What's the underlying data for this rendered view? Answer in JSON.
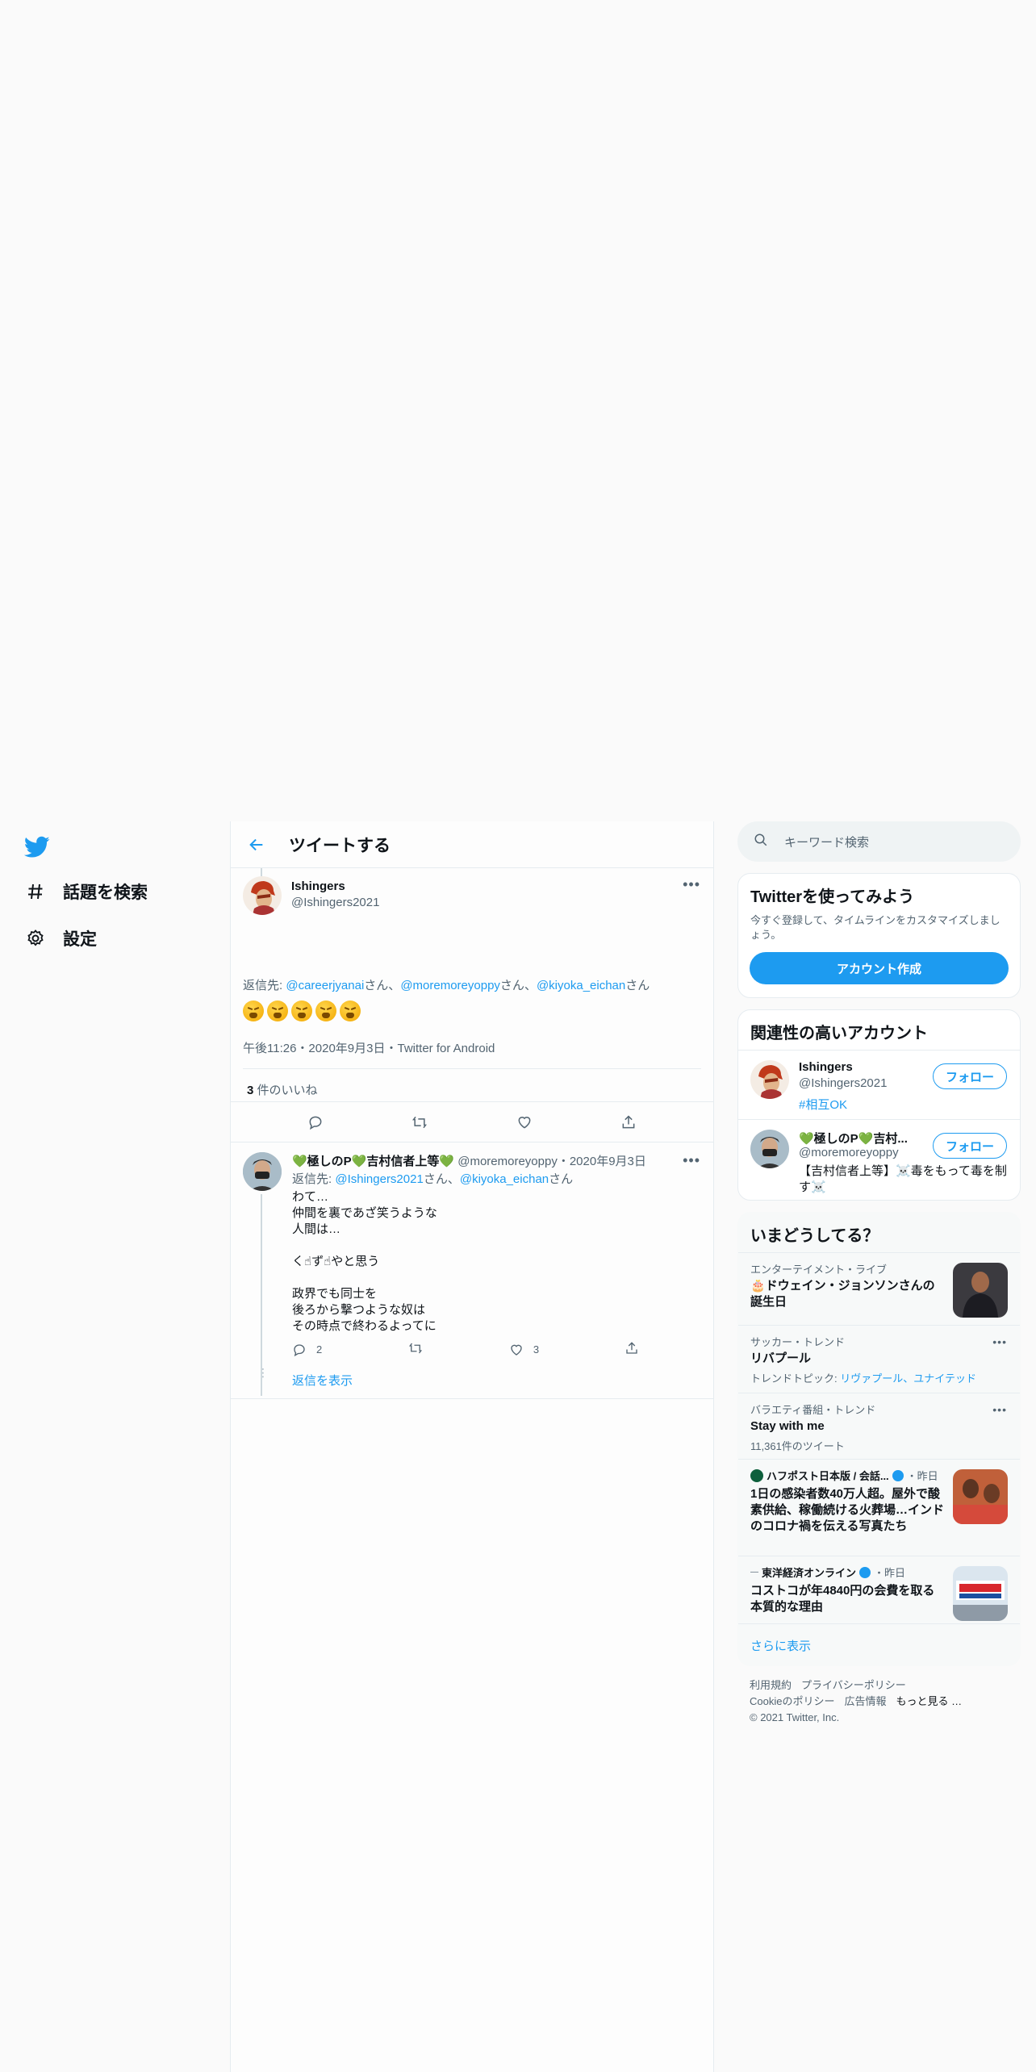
{
  "nav": {
    "items": [
      {
        "label": "話題を検索",
        "icon": "hashtag-icon"
      },
      {
        "label": "設定",
        "icon": "gear-icon"
      }
    ]
  },
  "header": {
    "title": "ツイートする"
  },
  "main_tweet": {
    "name": "Ishingers",
    "handle": "@Ishingers2021",
    "reply_prefix": "返信先: ",
    "reply_users": [
      "@careerjyanai",
      "@moremoreyoppy",
      "@kiyoka_eichan"
    ],
    "san": "さん",
    "emoji_count": 5,
    "meta": "午後11:26・2020年9月3日・Twitter for Android",
    "likes_count": "3",
    "likes_label": " 件のいいね"
  },
  "reply_tweet": {
    "name": "💚極しのP💚吉村信者上等💚",
    "handle": "@moremoreyoppy",
    "date": "・2020年9月3日",
    "reply_prefix": "返信先: ",
    "reply_users": [
      "@Ishingers2021",
      "@kiyoka_eichan"
    ],
    "san": "さん",
    "body": "わて…\n仲間を裏であざ笑うような\n人間は…\n\nく☝ず☝やと思う\n\n政界でも同士を\n後ろから撃つような奴は\nその時点で終わるよってに",
    "replies": "2",
    "likes": "3",
    "show_replies": "返信を表示"
  },
  "search": {
    "placeholder": "キーワード検索"
  },
  "signup": {
    "title": "Twitterを使ってみよう",
    "desc": "今すぐ登録して、タイムラインをカスタマイズしましょう。",
    "button": "アカウント作成"
  },
  "related": {
    "title": "関連性の高いアカウント",
    "follow": "フォロー",
    "accounts": [
      {
        "name": "Ishingers",
        "handle": "@Ishingers2021",
        "bio": "#相互OK"
      },
      {
        "name": "💚極しのP💚吉村...",
        "handle": "@moremoreyoppy",
        "bio": "【吉村信者上等】☠️毒をもって毒を制す☠️"
      }
    ]
  },
  "trends": {
    "title": "いまどうしてる？",
    "items": [
      {
        "context": "エンターテイメント・ライブ",
        "title": "🎂ドウェイン・ジョンソンさんの誕生日"
      },
      {
        "context": "サッカー・トレンド",
        "title": "リバプール",
        "sub_prefix": "トレンドトピック: ",
        "sub_links": "リヴァプール、ユナイテッド"
      },
      {
        "context": "バラエティ番組・トレンド",
        "title": "Stay with me",
        "sub": "11,361件のツイート"
      },
      {
        "context": "ハフポスト日本版 / 会話...",
        "time": "・昨日",
        "title": "1日の感染者数40万人超。屋外で酸素供給、稼働続ける火葬場…インドのコロナ禍を伝える写真たち"
      },
      {
        "context": "東洋経済オンライン",
        "time": "・昨日",
        "title": "コストコが年4840円の会費を取る本質的な理由"
      }
    ],
    "show_more": "さらに表示"
  },
  "footer": {
    "links": [
      "利用規約",
      "プライバシーポリシー",
      "Cookieのポリシー",
      "広告情報",
      "もっと見る …"
    ],
    "copyright": "© 2021 Twitter, Inc."
  },
  "colors": {
    "accent": "#1d9bf0",
    "text": "#0f1419",
    "muted": "#536471",
    "border": "#e6ecf0"
  }
}
